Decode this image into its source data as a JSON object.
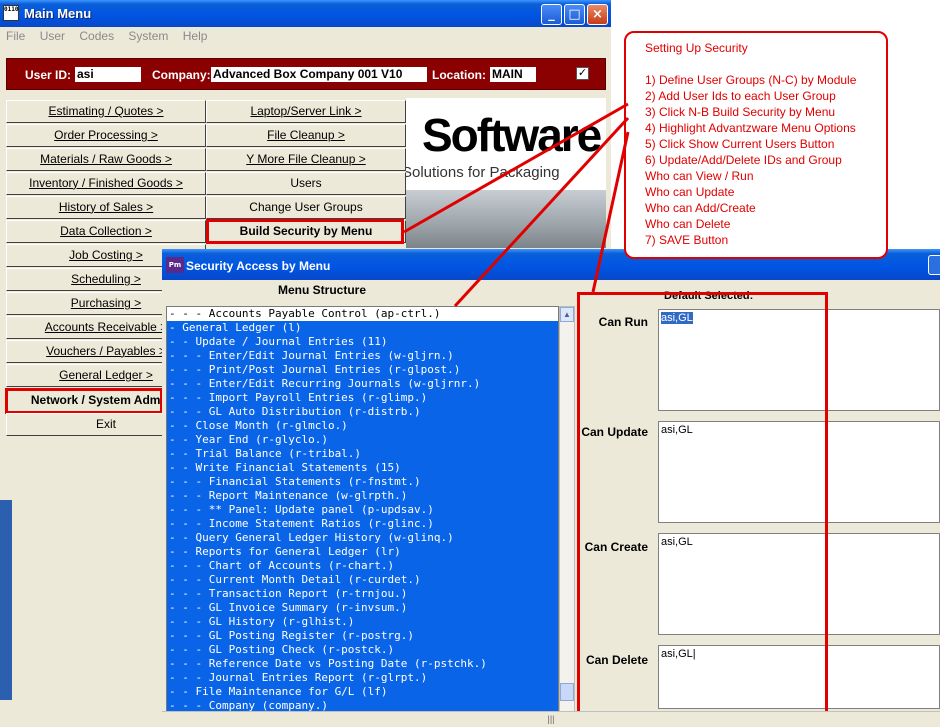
{
  "main_window": {
    "title": "Main Menu",
    "app_icon_text": "0110",
    "menu": [
      "File",
      "User",
      "Codes",
      "System",
      "Help"
    ],
    "user_id_label": "User ID:",
    "user_id": "asi",
    "company_label": "Company:",
    "company": "Advanced Box Company 001 V10",
    "location_label": "Location:",
    "location": "MAIN",
    "left_buttons": [
      "Estimating / Quotes >",
      "Order Processing >",
      "Materials / Raw Goods >",
      "Inventory / Finished Goods >",
      "History of Sales >",
      "Data Collection >",
      "Job Costing >",
      "Scheduling >",
      "Purchasing >",
      "Accounts Receivable >",
      "Vouchers / Payables >",
      "General Ledger >",
      "Network / System Adminis",
      "Exit"
    ],
    "right_buttons": [
      "Laptop/Server Link >",
      "File Cleanup >",
      "Y More File Cleanup >",
      "Users",
      "Change User Groups",
      "Build Security by Menu"
    ],
    "logo_word": "Software",
    "logo_tagline": "Solutions for Packaging"
  },
  "security_window": {
    "title": "Security Access by Menu",
    "menu_structure_label": "Menu Structure",
    "default_selected": "Default Selected:",
    "tree_rows": [
      "- - - Accounts Payable Control (ap-ctrl.)",
      "- General Ledger (l)",
      "- - Update / Journal Entries (11)",
      "- - - Enter/Edit Journal Entries (w-gljrn.)",
      "- - - Print/Post Journal Entries (r-glpost.)",
      "- - - Enter/Edit Recurring Journals (w-gljrnr.)",
      "- - - Import Payroll Entries (r-glimp.)",
      "- - - GL Auto Distribution (r-distrb.)",
      "- - Close Month (r-glmclo.)",
      "- - Year End (r-glyclo.)",
      "- - Trial Balance (r-tribal.)",
      "- - Write Financial Statements (15)",
      "- - - Financial Statements (r-fnstmt.)",
      "- - - Report Maintenance (w-glrpth.)",
      "- - - ** Panel: Update panel (p-updsav.)",
      "- - - Income Statement Ratios (r-glinc.)",
      "- - Query General Ledger History (w-glinq.)",
      "- - Reports for General Ledger (lr)",
      "- - - Chart of Accounts (r-chart.)",
      "- - - Current Month Detail (r-curdet.)",
      "- - - Transaction Report (r-trnjou.)",
      "- - - GL Invoice Summary (r-invsum.)",
      "- - - GL History (r-glhist.)",
      "- - - GL Posting Register (r-postrg.)",
      "- - - GL Posting Check (r-postck.)",
      "- - - Reference Date vs Posting Date (r-pstchk.)",
      "- - - Journal Entries Report (r-glrpt.)",
      "- - File Maintenance for G/L (lf)",
      "- - - Company (company.)"
    ],
    "can_run_label": "Can Run",
    "can_run_value": "asi,GL",
    "can_update_label": "Can Update",
    "can_update_value": "asi,GL",
    "can_create_label": "Can Create",
    "can_create_value": "asi,GL",
    "can_delete_label": "Can Delete",
    "can_delete_value": "asi,GL|"
  },
  "callout": {
    "lines": [
      "Setting Up Security",
      "",
      "1)  Define User Groups (N-C) by Module",
      "2)  Add User Ids to each User Group",
      "3)  Click N-B  Build Security by Menu",
      "4)  Highlight Advantzware Menu Options",
      "5)  Click Show Current Users Button",
      "6)  Update/Add/Delete IDs and Group",
      "     Who can View / Run",
      "     Who can Update",
      "     Who can Add/Create",
      "     Who can Delete",
      "7)  SAVE Button"
    ]
  },
  "colors": {
    "annotation_red": "#e00000",
    "title_blue": "#0054e3",
    "selection_blue": "#0a64e8",
    "header_strip": "#8b0000"
  }
}
